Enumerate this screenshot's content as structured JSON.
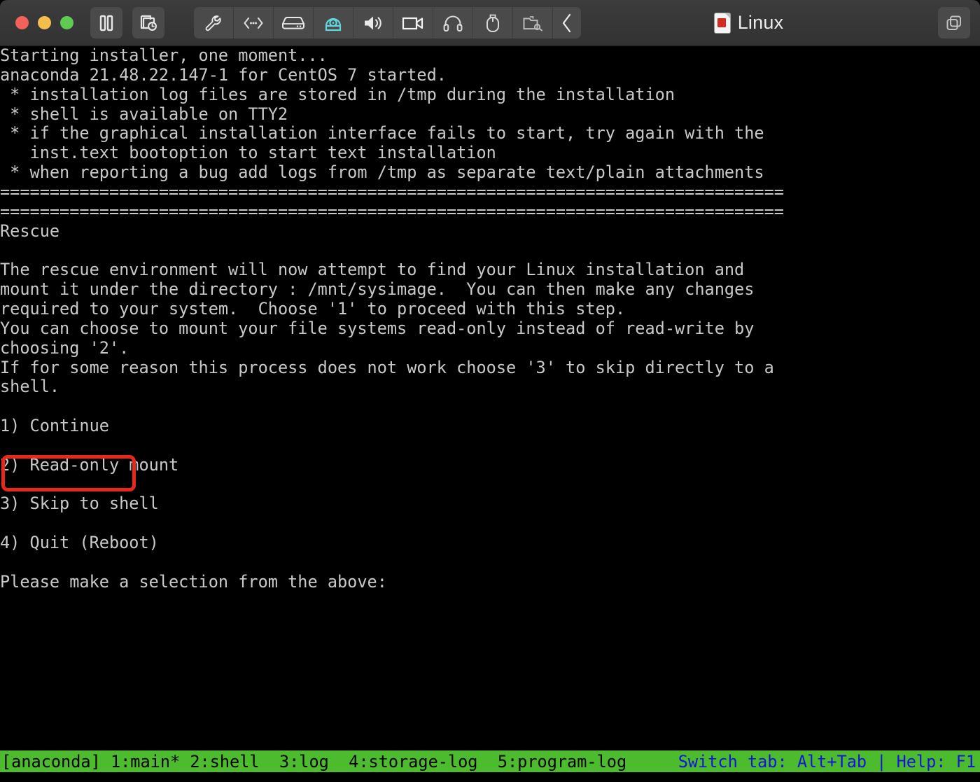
{
  "window": {
    "title": "Linux",
    "title_icon": "vm-document-icon",
    "traffic_lights": [
      {
        "name": "close-button",
        "color": "#f2615a"
      },
      {
        "name": "minimize-button",
        "color": "#f2bf4f"
      },
      {
        "name": "maximize-button",
        "color": "#5fcb53"
      }
    ],
    "left_buttons": [
      {
        "name": "pause-button",
        "icon": "pause-icon"
      },
      {
        "name": "snapshot-button",
        "icon": "snapshot-clock-icon"
      }
    ],
    "device_buttons": [
      {
        "name": "settings-button",
        "icon": "wrench-icon",
        "active": false
      },
      {
        "name": "network-button",
        "icon": "network-arrows-icon",
        "active": false
      },
      {
        "name": "hard-disk-button",
        "icon": "hard-disk-icon",
        "active": false
      },
      {
        "name": "cd-dvd-button",
        "icon": "cd-dvd-icon",
        "active": true
      },
      {
        "name": "sound-button",
        "icon": "speaker-icon",
        "active": false
      },
      {
        "name": "camera-button",
        "icon": "video-camera-icon",
        "active": false
      },
      {
        "name": "headphones-button",
        "icon": "headphones-icon",
        "active": false
      },
      {
        "name": "usb-mouse-button",
        "icon": "mouse-icon",
        "active": false
      },
      {
        "name": "shared-folder-button",
        "icon": "shared-folder-icon",
        "active": false
      },
      {
        "name": "collapse-toolbar",
        "icon": "chevron-left-icon",
        "active": false
      }
    ],
    "right_buttons": [
      {
        "name": "view-mode-button",
        "icon": "windows-stack-icon"
      }
    ]
  },
  "console": {
    "accent_highlight_color": "#e8281c",
    "foreground_color": "#c9c9c9",
    "background_color": "#000000",
    "separator": "===============================================================================",
    "lines": [
      "Starting installer, one moment...",
      "anaconda 21.48.22.147-1 for CentOS 7 started.",
      " * installation log files are stored in /tmp during the installation",
      " * shell is available on TTY2",
      " * if the graphical installation interface fails to start, try again with the",
      "   inst.text bootoption to start text installation",
      " * when reporting a bug add logs from /tmp as separate text/plain attachments",
      "===============================================================================",
      "===============================================================================",
      "Rescue",
      "",
      "The rescue environment will now attempt to find your Linux installation and",
      "mount it under the directory : /mnt/sysimage.  You can then make any changes",
      "required to your system.  Choose '1' to proceed with this step.",
      "You can choose to mount your file systems read-only instead of read-write by",
      "choosing '2'.",
      "If for some reason this process does not work choose '3' to skip directly to a",
      "shell.",
      "",
      "1) Continue",
      "",
      "2) Read-only mount",
      "",
      "3) Skip to shell",
      "",
      "4) Quit (Reboot)",
      "",
      "Please make a selection from the above:"
    ],
    "menu_options": [
      {
        "key": "1",
        "label": "1) Continue",
        "highlighted": true
      },
      {
        "key": "2",
        "label": "2) Read-only mount",
        "highlighted": false
      },
      {
        "key": "3",
        "label": "3) Skip to shell",
        "highlighted": false
      },
      {
        "key": "4",
        "label": "4) Quit (Reboot)",
        "highlighted": false
      }
    ],
    "prompt": "Please make a selection from the above:"
  },
  "status_bar": {
    "background_color": "#4cbb2e",
    "left_text_color": "#000000",
    "right_text_color": "#1414d8",
    "left": "[anaconda] 1:main* 2:shell  3:log  4:storage-log  5:program-log",
    "right": "Switch tab: Alt+Tab | Help: F1",
    "tabs": [
      {
        "index": "1",
        "name": "main",
        "label": "1:main*",
        "active": true
      },
      {
        "index": "2",
        "name": "shell",
        "label": "2:shell",
        "active": false
      },
      {
        "index": "3",
        "name": "log",
        "label": "3:log",
        "active": false
      },
      {
        "index": "4",
        "name": "storage-log",
        "label": "4:storage-log",
        "active": false
      },
      {
        "index": "5",
        "name": "program-log",
        "label": "5:program-log",
        "active": false
      }
    ],
    "session_name": "[anaconda]"
  }
}
